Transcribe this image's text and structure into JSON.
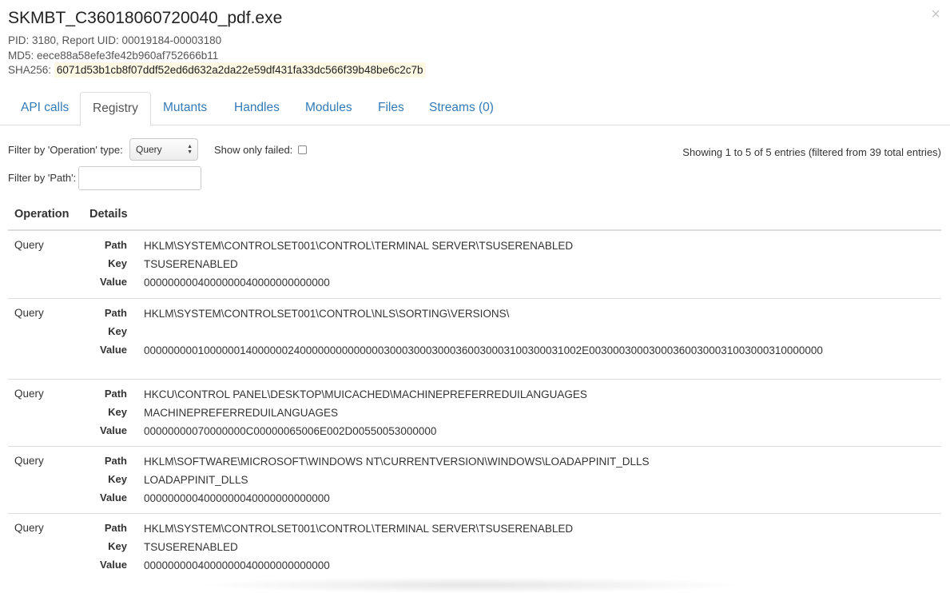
{
  "dialog": {
    "title": "SKMBT_C36018060720040_pdf.exe",
    "close_symbol": "×",
    "pid_line": "PID: 3180, Report UID: 00019184-00003180",
    "md5_line": "MD5: eece88a58efe3fe42b960af752666b11",
    "sha256_label": "SHA256:",
    "sha256_value": "6071d53b1cb8f07ddf52ed6d632a2da22e59df431fa33dc566f39b48be6c2c7b"
  },
  "tabs": [
    {
      "label": "API calls"
    },
    {
      "label": "Registry"
    },
    {
      "label": "Mutants"
    },
    {
      "label": "Handles"
    },
    {
      "label": "Modules"
    },
    {
      "label": "Files"
    },
    {
      "label": "Streams (0)"
    }
  ],
  "active_tab": "Registry",
  "filters": {
    "operation_label": "Filter by 'Operation' type:",
    "operation_value": "Query",
    "failed_label": "Show only failed:",
    "failed_checked": false,
    "path_label": "Filter by 'Path':",
    "path_value": "",
    "entries_info": "Showing 1 to 5 of 5 entries (filtered from 39 total entries)"
  },
  "table": {
    "columns": [
      "Operation",
      "Details"
    ],
    "field_labels": {
      "path": "Path",
      "key": "Key",
      "value": "Value"
    },
    "rows": [
      {
        "operation": "Query",
        "path": "HKLM\\SYSTEM\\CONTROLSET001\\CONTROL\\TERMINAL SERVER\\TSUSERENABLED",
        "key": "TSUSERENABLED",
        "value": "0000000004000000040000000000000"
      },
      {
        "operation": "Query",
        "path": "HKLM\\SYSTEM\\CONTROLSET001\\CONTROL\\NLS\\SORTING\\VERSIONS\\",
        "key": "",
        "value": "0000000001000000140000002400000000000000300030003000360030003100300031002E003000300030003600300031003000310000000"
      },
      {
        "operation": "Query",
        "path": "HKCU\\CONTROL PANEL\\DESKTOP\\MUICACHED\\MACHINEPREFERREDUILANGUAGES",
        "key": "MACHINEPREFERREDUILANGUAGES",
        "value": "00000000070000000C00000065006E002D00550053000000"
      },
      {
        "operation": "Query",
        "path": "HKLM\\SOFTWARE\\MICROSOFT\\WINDOWS NT\\CURRENTVERSION\\WINDOWS\\LOADAPPINIT_DLLS",
        "key": "LOADAPPINIT_DLLS",
        "value": "0000000004000000040000000000000"
      },
      {
        "operation": "Query",
        "path": "HKLM\\SYSTEM\\CONTROLSET001\\CONTROL\\TERMINAL SERVER\\TSUSERENABLED",
        "key": "TSUSERENABLED",
        "value": "0000000004000000040000000000000"
      }
    ]
  }
}
